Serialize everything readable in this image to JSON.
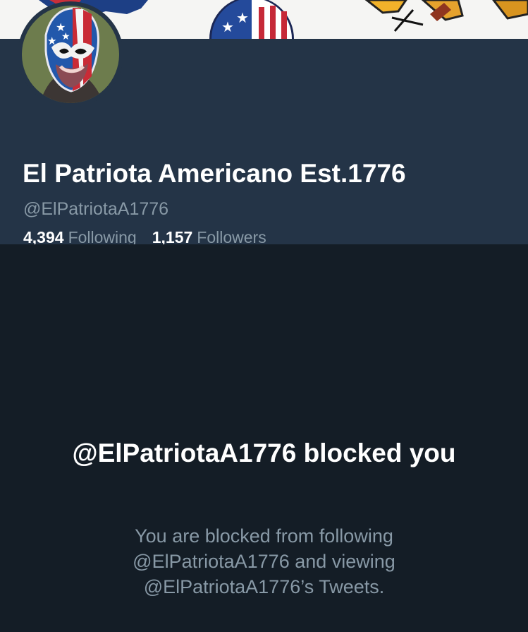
{
  "profile": {
    "display_name": "El Patriota Americano Est.1776",
    "handle": "@ElPatriotaA1776",
    "following_count": "4,394",
    "following_label": "Following",
    "followers_count": "1,157",
    "followers_label": "Followers"
  },
  "blocked_notice": {
    "title": "@ElPatriotaA1776 blocked you",
    "message": "You are blocked from following @ElPatriotaA1776 and viewing @ElPatriotaA1776’s Tweets."
  },
  "colors": {
    "page_background": "#141d26",
    "profile_panel": "#243447",
    "primary_text": "#ffffff",
    "secondary_text": "#8899a6"
  }
}
